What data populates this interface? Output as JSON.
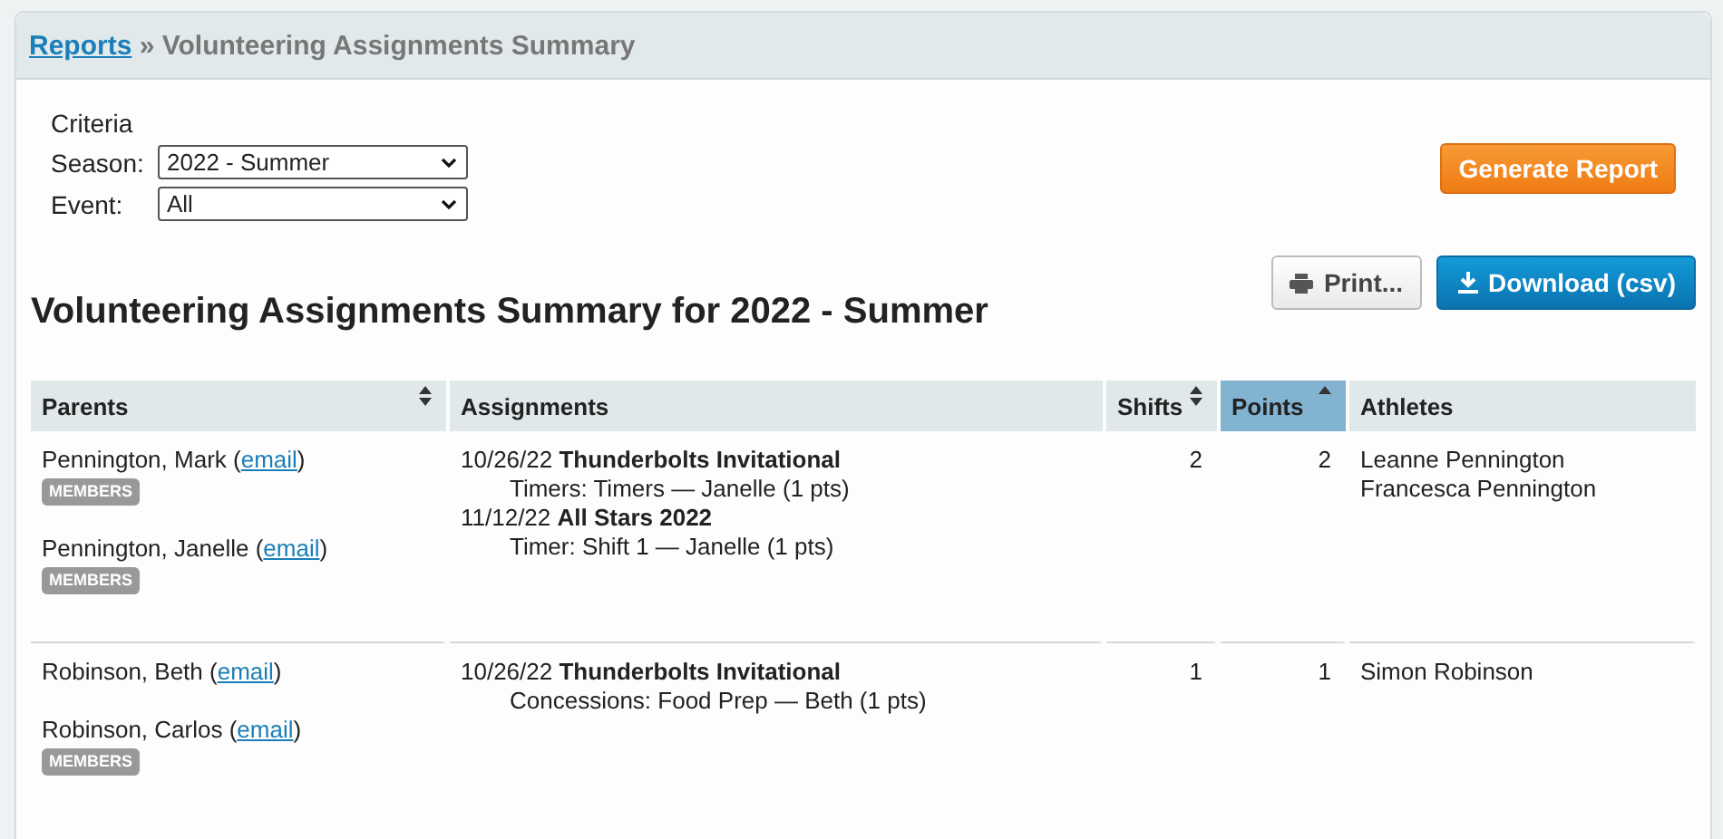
{
  "breadcrumb": {
    "link": "Reports",
    "separator": "»",
    "current": "Volunteering Assignments Summary"
  },
  "criteria": {
    "heading": "Criteria",
    "fields": [
      {
        "label": "Season:",
        "value": "2022 - Summer"
      },
      {
        "label": "Event:",
        "value": "All"
      }
    ]
  },
  "generate_button": "Generate Report",
  "report_title": "Volunteering Assignments Summary for 2022 - Summer",
  "print_button": "Print...",
  "download_button": "Download (csv)",
  "table": {
    "columns": [
      {
        "label": "Parents",
        "sortable": true,
        "selected": false
      },
      {
        "label": "Assignments",
        "sortable": false,
        "selected": false
      },
      {
        "label": "Shifts",
        "sortable": true,
        "selected": false
      },
      {
        "label": "Points",
        "sortable": true,
        "selected": true
      },
      {
        "label": "Athletes",
        "sortable": false,
        "selected": false
      }
    ],
    "rows": [
      {
        "parents": [
          {
            "name": "Pennington, Mark (",
            "link": "email",
            "after": ")",
            "badge": "MEMBERS"
          },
          {
            "name": "Pennington, Janelle (",
            "link": "email",
            "after": ")",
            "badge": "MEMBERS"
          }
        ],
        "assignments": [
          {
            "event": "10/26/22 **Thunderbolts Invitational**",
            "details": [
              "Timers: Timers — Janelle (1 pts)"
            ]
          },
          {
            "event": "11/12/22 **All Stars 2022**",
            "details": [
              "Timer: Shift 1 — Janelle (1 pts)"
            ]
          }
        ],
        "shifts": "2",
        "points": "2",
        "athletes": [
          "Leanne Pennington",
          "Francesca Pennington"
        ]
      },
      {
        "parents": [
          {
            "name": "Robinson, Beth (",
            "link": "email",
            "after": ")"
          },
          {
            "name": "Robinson, Carlos (",
            "link": "email",
            "after": ")",
            "badge": "MEMBERS"
          }
        ],
        "assignments": [
          {
            "event": "10/26/22 **Thunderbolts Invitational**",
            "details": [
              "Concessions: Food Prep — Beth (1 pts)"
            ]
          }
        ],
        "shifts": "1",
        "points": "1",
        "athletes": [
          "Simon Robinson"
        ]
      }
    ]
  }
}
